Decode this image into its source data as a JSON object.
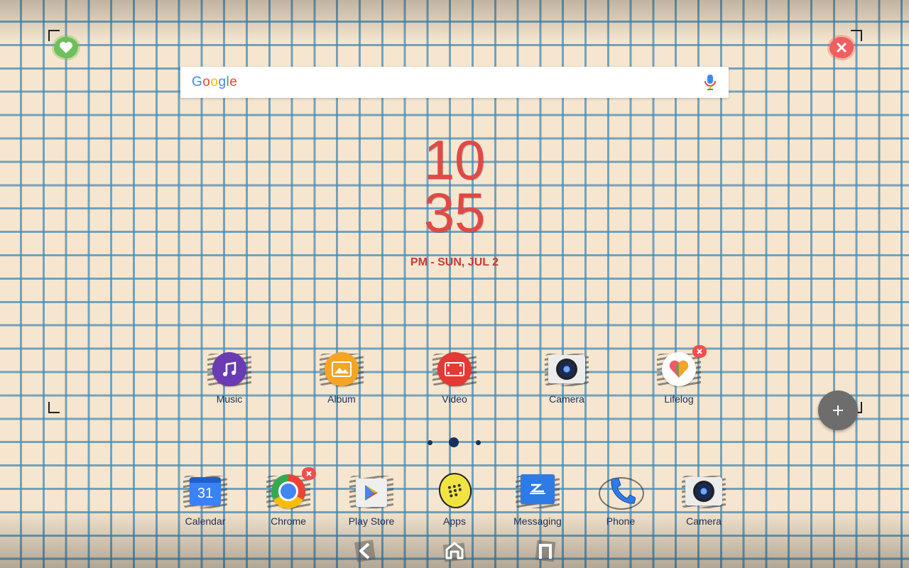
{
  "search": {
    "logo_letters": [
      "G",
      "o",
      "o",
      "g",
      "l",
      "e"
    ]
  },
  "clock": {
    "hour": "10",
    "minute": "35",
    "date": "PM - SUN, JUL 2"
  },
  "home_apps": [
    {
      "label": "Music",
      "icon": "music-icon",
      "color": "#6a3bb3"
    },
    {
      "label": "Album",
      "icon": "album-icon",
      "color": "#f5a524"
    },
    {
      "label": "Video",
      "icon": "video-icon",
      "color": "#e53935"
    },
    {
      "label": "Camera",
      "icon": "camera-icon",
      "color": "#e8e8e8"
    },
    {
      "label": "Lifelog",
      "icon": "lifelog-icon",
      "color": "#ffffff"
    }
  ],
  "dock_apps": [
    {
      "label": "Calendar",
      "icon": "calendar-icon",
      "day": "31",
      "color": "#3b82f6"
    },
    {
      "label": "Chrome",
      "icon": "chrome-icon"
    },
    {
      "label": "Play Store",
      "icon": "play-store-icon"
    },
    {
      "label": "Apps",
      "icon": "apps-icon",
      "color": "#f0e442"
    },
    {
      "label": "Messaging",
      "icon": "messaging-icon",
      "color": "#2f7be5"
    },
    {
      "label": "Phone",
      "icon": "phone-icon",
      "color": "#2f7be5"
    },
    {
      "label": "Camera",
      "icon": "camera-icon",
      "color": "#e8e8e8"
    }
  ],
  "colors": {
    "clock": "#e04a45",
    "labels": "#1b2e57",
    "remove": "#ef5f5f",
    "favorite": "#6fbf5a"
  }
}
